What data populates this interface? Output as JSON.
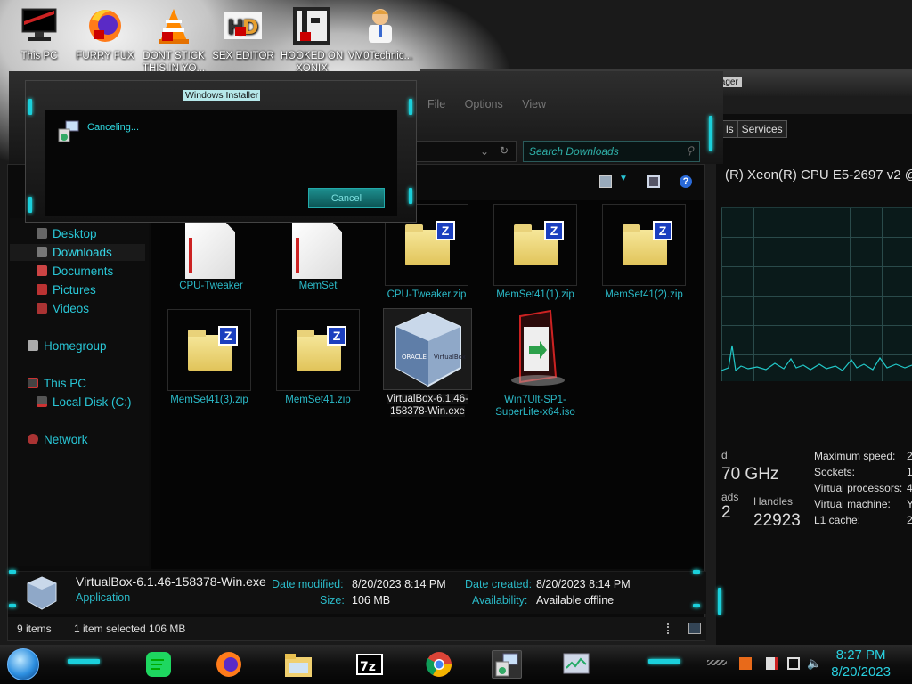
{
  "desktop": {
    "icons": [
      {
        "label": "This PC",
        "icon": "computer-icon"
      },
      {
        "label": "FURRY FUX",
        "icon": "firefox-icon"
      },
      {
        "label": "DONT STICK THIS IN YO...",
        "icon": "vlc-icon"
      },
      {
        "label": "SEX EDITOR",
        "icon": "hxd-icon"
      },
      {
        "label": "HOOKED ON XONIX",
        "icon": "game-icon"
      },
      {
        "label": "VM0Technic...",
        "icon": "doctor-icon"
      }
    ]
  },
  "installer": {
    "title": "Windows Installer",
    "message": "Canceling...",
    "cancel_label": "Cancel"
  },
  "task_manager": {
    "title": "Task Manager",
    "menu": [
      "File",
      "Options",
      "View"
    ],
    "tab_partial": "ls",
    "tab_services": "Services",
    "cpu_name": "(R) Xeon(R) CPU E5-2697 v2 @",
    "speed_label_partial": "d",
    "speed_value_partial": "70 GHz",
    "threads_label_partial": "ads",
    "threads_value_partial": "2",
    "handles_label": "Handles",
    "handles_value": "22923",
    "right_labels": [
      "Maximum speed:",
      "Sockets:",
      "Virtual processors:",
      "Virtual machine:",
      "L1 cache:"
    ],
    "right_values_partial": [
      "2",
      "1",
      "4",
      "Y",
      "2"
    ]
  },
  "explorer": {
    "search_placeholder": "Search Downloads",
    "nav": [
      {
        "label": "Desktop",
        "icon": "desktop-icon",
        "level": 1,
        "selected": false
      },
      {
        "label": "Downloads",
        "icon": "downloads-icon",
        "level": 1,
        "selected": true
      },
      {
        "label": "Documents",
        "icon": "documents-icon",
        "level": 1,
        "selected": false
      },
      {
        "label": "Pictures",
        "icon": "pictures-icon",
        "level": 1,
        "selected": false
      },
      {
        "label": "Videos",
        "icon": "videos-icon",
        "level": 1,
        "selected": false
      },
      {
        "label": "Homegroup",
        "icon": "homegroup-icon",
        "level": 0,
        "selected": false
      },
      {
        "label": "This PC",
        "icon": "pc-icon",
        "level": 0,
        "selected": false
      },
      {
        "label": "Local Disk (C:)",
        "icon": "disk-icon",
        "level": 1,
        "selected": false
      },
      {
        "label": "Network",
        "icon": "network-icon",
        "level": 0,
        "selected": false
      }
    ],
    "files": [
      {
        "name": "CPU-Tweaker",
        "kind": "folder-doc"
      },
      {
        "name": "MemSet",
        "kind": "folder-doc"
      },
      {
        "name": "CPU-Tweaker.zip",
        "kind": "zip"
      },
      {
        "name": "MemSet41(1).zip",
        "kind": "zip"
      },
      {
        "name": "MemSet41(2).zip",
        "kind": "zip"
      },
      {
        "name": "MemSet41(3).zip",
        "kind": "zip"
      },
      {
        "name": "MemSet41.zip",
        "kind": "zip"
      },
      {
        "name": "VirtualBox-6.1.46-158378-Win.exe",
        "kind": "virtualbox"
      },
      {
        "name": "Win7Ult-SP1-SuperLite-x64.iso",
        "kind": "iso"
      }
    ],
    "details": {
      "name": "VirtualBox-6.1.46-158378-Win.exe",
      "type": "Application",
      "modified_label": "Date modified:",
      "modified_value": "8/20/2023 8:14 PM",
      "size_label": "Size:",
      "size_value": "106 MB",
      "created_label": "Date created:",
      "created_value": "8/20/2023 8:14 PM",
      "availability_label": "Availability:",
      "availability_value": "Available offline"
    },
    "status": {
      "items": "9 items",
      "selection": "1 item selected  106 MB"
    }
  },
  "taskbar": {
    "apps": [
      "spotify-icon",
      "firefox-icon",
      "file-explorer-icon",
      "7zip-icon",
      "chrome-icon",
      "installer-icon",
      "task-manager-icon"
    ],
    "time": "8:27 PM",
    "date": "8/20/2023",
    "colors": {
      "accent": "#1bd0dc"
    }
  }
}
